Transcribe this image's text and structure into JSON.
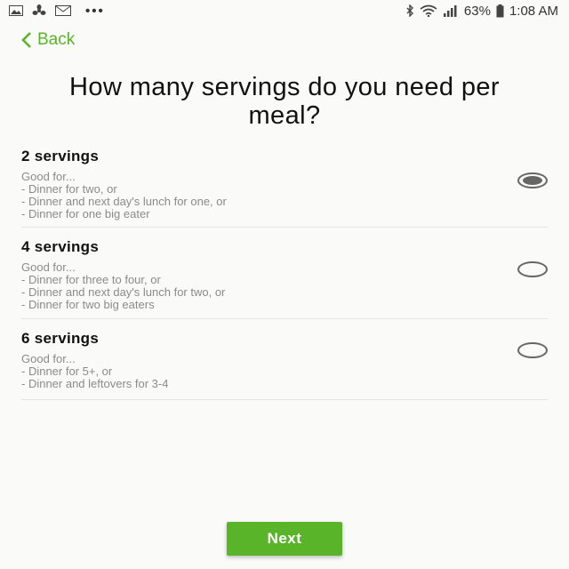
{
  "status_bar": {
    "icons_left": [
      "gallery-icon",
      "fan-icon",
      "email-icon"
    ],
    "more": "•••",
    "battery_percent": "63%",
    "time": "1:08 AM"
  },
  "nav": {
    "back_label": "Back"
  },
  "question": {
    "title": "How many servings do you need per meal?"
  },
  "options": [
    {
      "title": "2 servings",
      "subtitle": "Good for...",
      "lines": [
        "- Dinner for two, or",
        "- Dinner and next day's lunch for one, or",
        "- Dinner for one big eater"
      ],
      "selected": true
    },
    {
      "title": "4 servings",
      "subtitle": "Good for...",
      "lines": [
        "- Dinner for three to four, or",
        "- Dinner and next day's lunch for two, or",
        "- Dinner for two big eaters"
      ],
      "selected": false
    },
    {
      "title": "6 servings",
      "subtitle": "Good for...",
      "lines": [
        "- Dinner for 5+, or",
        "- Dinner and leftovers for 3-4"
      ],
      "selected": false
    }
  ],
  "footer": {
    "next_label": "Next"
  },
  "colors": {
    "accent": "#5ab42a",
    "radio": "#666666"
  }
}
